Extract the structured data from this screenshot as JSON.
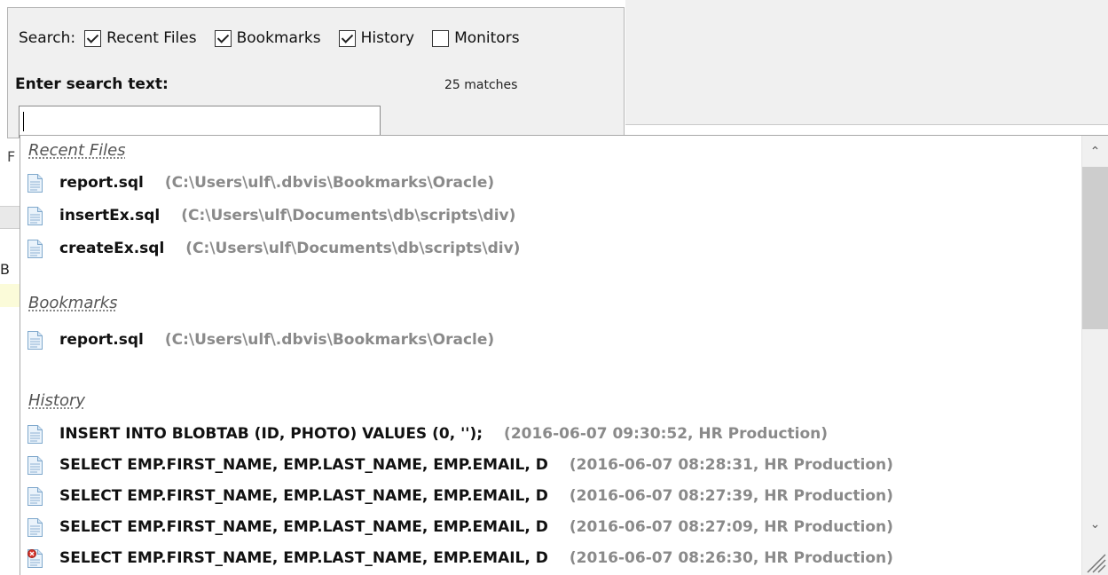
{
  "search": {
    "label": "Search:",
    "options": [
      {
        "label": "Recent Files",
        "checked": true
      },
      {
        "label": "Bookmarks",
        "checked": true
      },
      {
        "label": "History",
        "checked": true
      },
      {
        "label": "Monitors",
        "checked": false
      }
    ],
    "prompt": "Enter search text:",
    "match_count": "25 matches",
    "input_value": "",
    "side_label": "F"
  },
  "background": {
    "left_glyph": "B"
  },
  "results": {
    "recent_files": {
      "title": "Recent Files",
      "items": [
        {
          "name": "report.sql",
          "path": "(C:\\Users\\ulf\\.dbvis\\Bookmarks\\Oracle)"
        },
        {
          "name": "insertEx.sql",
          "path": "(C:\\Users\\ulf\\Documents\\db\\scripts\\div)"
        },
        {
          "name": "createEx.sql",
          "path": "(C:\\Users\\ulf\\Documents\\db\\scripts\\div)"
        }
      ]
    },
    "bookmarks": {
      "title": "Bookmarks",
      "items": [
        {
          "name": "report.sql",
          "path": "(C:\\Users\\ulf\\.dbvis\\Bookmarks\\Oracle)"
        }
      ]
    },
    "history": {
      "title": "History",
      "items": [
        {
          "name": "INSERT INTO BLOBTAB (ID, PHOTO) VALUES (0, '');",
          "path": "(2016-06-07 09:30:52,  HR Production)",
          "icon": "document-icon"
        },
        {
          "name": "SELECT EMP.FIRST_NAME, EMP.LAST_NAME, EMP.EMAIL, D",
          "path": "(2016-06-07 08:28:31,  HR Production)",
          "icon": "document-icon"
        },
        {
          "name": "SELECT EMP.FIRST_NAME, EMP.LAST_NAME, EMP.EMAIL, D",
          "path": "(2016-06-07 08:27:39,  HR Production)",
          "icon": "document-icon"
        },
        {
          "name": "SELECT EMP.FIRST_NAME, EMP.LAST_NAME, EMP.EMAIL, D",
          "path": "(2016-06-07 08:27:09,  HR Production)",
          "icon": "document-icon"
        },
        {
          "name": "SELECT EMP.FIRST_NAME, EMP.LAST_NAME, EMP.EMAIL, D",
          "path": "(2016-06-07 08:26:30,  HR Production)",
          "icon": "document-error-icon"
        }
      ]
    }
  },
  "colors": {
    "panel_bg": "#f0f0f0",
    "path_gray": "#8a8a8a",
    "error_red": "#d9342b"
  }
}
